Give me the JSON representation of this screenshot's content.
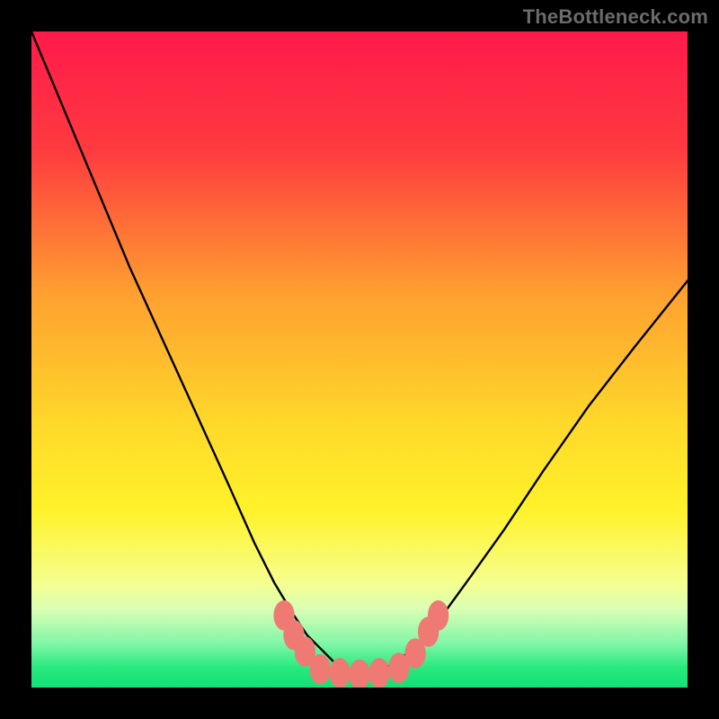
{
  "watermark": "TheBottleneck.com",
  "chart_data": {
    "type": "line",
    "title": "",
    "xlabel": "",
    "ylabel": "",
    "xlim": [
      0,
      100
    ],
    "ylim": [
      0,
      100
    ],
    "gradient_stops": [
      {
        "offset": 0,
        "color": "#ff1a4b"
      },
      {
        "offset": 18,
        "color": "#ff3a3f"
      },
      {
        "offset": 40,
        "color": "#ffa030"
      },
      {
        "offset": 60,
        "color": "#ffd92a"
      },
      {
        "offset": 73,
        "color": "#fff22a"
      },
      {
        "offset": 84,
        "color": "#f6ff8e"
      },
      {
        "offset": 88,
        "color": "#d9ffb4"
      },
      {
        "offset": 93,
        "color": "#87f7aa"
      },
      {
        "offset": 97,
        "color": "#27e97e"
      },
      {
        "offset": 100,
        "color": "#14df76"
      }
    ],
    "series": [
      {
        "name": "bottleneck-curve-left",
        "stroke": "#000000",
        "x": [
          0,
          5,
          10,
          15,
          20,
          25,
          30,
          34,
          37,
          40,
          42,
          44,
          46,
          48,
          50
        ],
        "y": [
          100,
          88,
          76,
          64,
          53,
          42,
          31,
          22,
          16,
          11,
          8,
          6,
          4,
          2.5,
          2
        ]
      },
      {
        "name": "bottleneck-curve-right",
        "stroke": "#000000",
        "x": [
          50,
          52,
          54,
          56,
          58,
          60,
          63,
          67,
          72,
          78,
          85,
          92,
          100
        ],
        "y": [
          2,
          2.3,
          3,
          4.2,
          5.8,
          8,
          11.5,
          17,
          24,
          33,
          43,
          52,
          62
        ]
      }
    ],
    "markers": {
      "name": "data-points",
      "color": "#ef7a74",
      "rx": 1.6,
      "ry": 2.3,
      "points": [
        {
          "x": 38.5,
          "y": 11
        },
        {
          "x": 40,
          "y": 8
        },
        {
          "x": 41.7,
          "y": 5.5
        },
        {
          "x": 44,
          "y": 2.8
        },
        {
          "x": 47,
          "y": 2.2
        },
        {
          "x": 50,
          "y": 2.0
        },
        {
          "x": 53,
          "y": 2.2
        },
        {
          "x": 56,
          "y": 3.0
        },
        {
          "x": 58.5,
          "y": 5.2
        },
        {
          "x": 60.5,
          "y": 8.5
        },
        {
          "x": 62,
          "y": 11
        }
      ]
    }
  }
}
